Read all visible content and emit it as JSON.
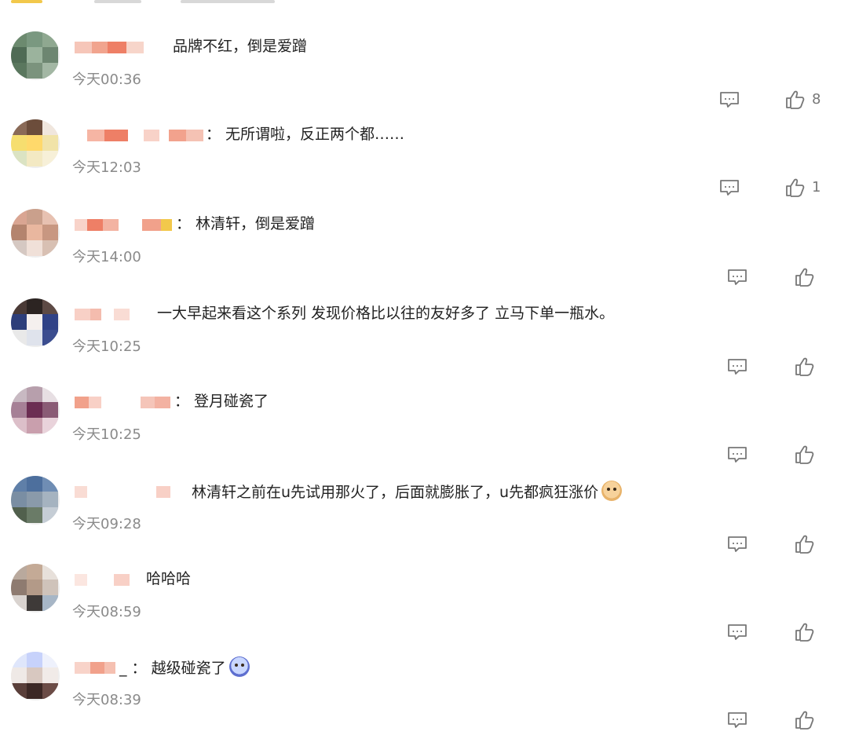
{
  "comments": [
    {
      "text": "品牌不红，倒是爱蹭",
      "time": "今天00:36",
      "likes": "8"
    },
    {
      "text": "： 无所谓啦，反正两个都……",
      "time": "今天12:03",
      "likes": "1"
    },
    {
      "text": "： 林清轩，倒是爱蹭",
      "time": "今天14:00",
      "likes": ""
    },
    {
      "text": "一大早起来看这个系列 发现价格比以往的友好多了 立马下单一瓶水。",
      "time": "今天10:25",
      "likes": ""
    },
    {
      "text": "： 登月碰瓷了",
      "time": "今天10:25",
      "likes": ""
    },
    {
      "text": "林清轩之前在u先试用那火了，后面就膨胀了，u先都疯狂涨价",
      "time": "今天09:28",
      "likes": ""
    },
    {
      "text": "哈哈哈",
      "time": "今天08:59",
      "likes": ""
    },
    {
      "text": "_ ： 越级碰瓷了",
      "time": "今天08:39",
      "likes": ""
    }
  ],
  "icons": {
    "reply": "comment-bubble-icon",
    "like": "thumbs-up-icon",
    "emoji": "emoji-face-icon"
  },
  "colors": {
    "text": "#222222",
    "time": "#8a8a8a",
    "icon": "#777777",
    "blur_accent": "#ee7f66"
  }
}
